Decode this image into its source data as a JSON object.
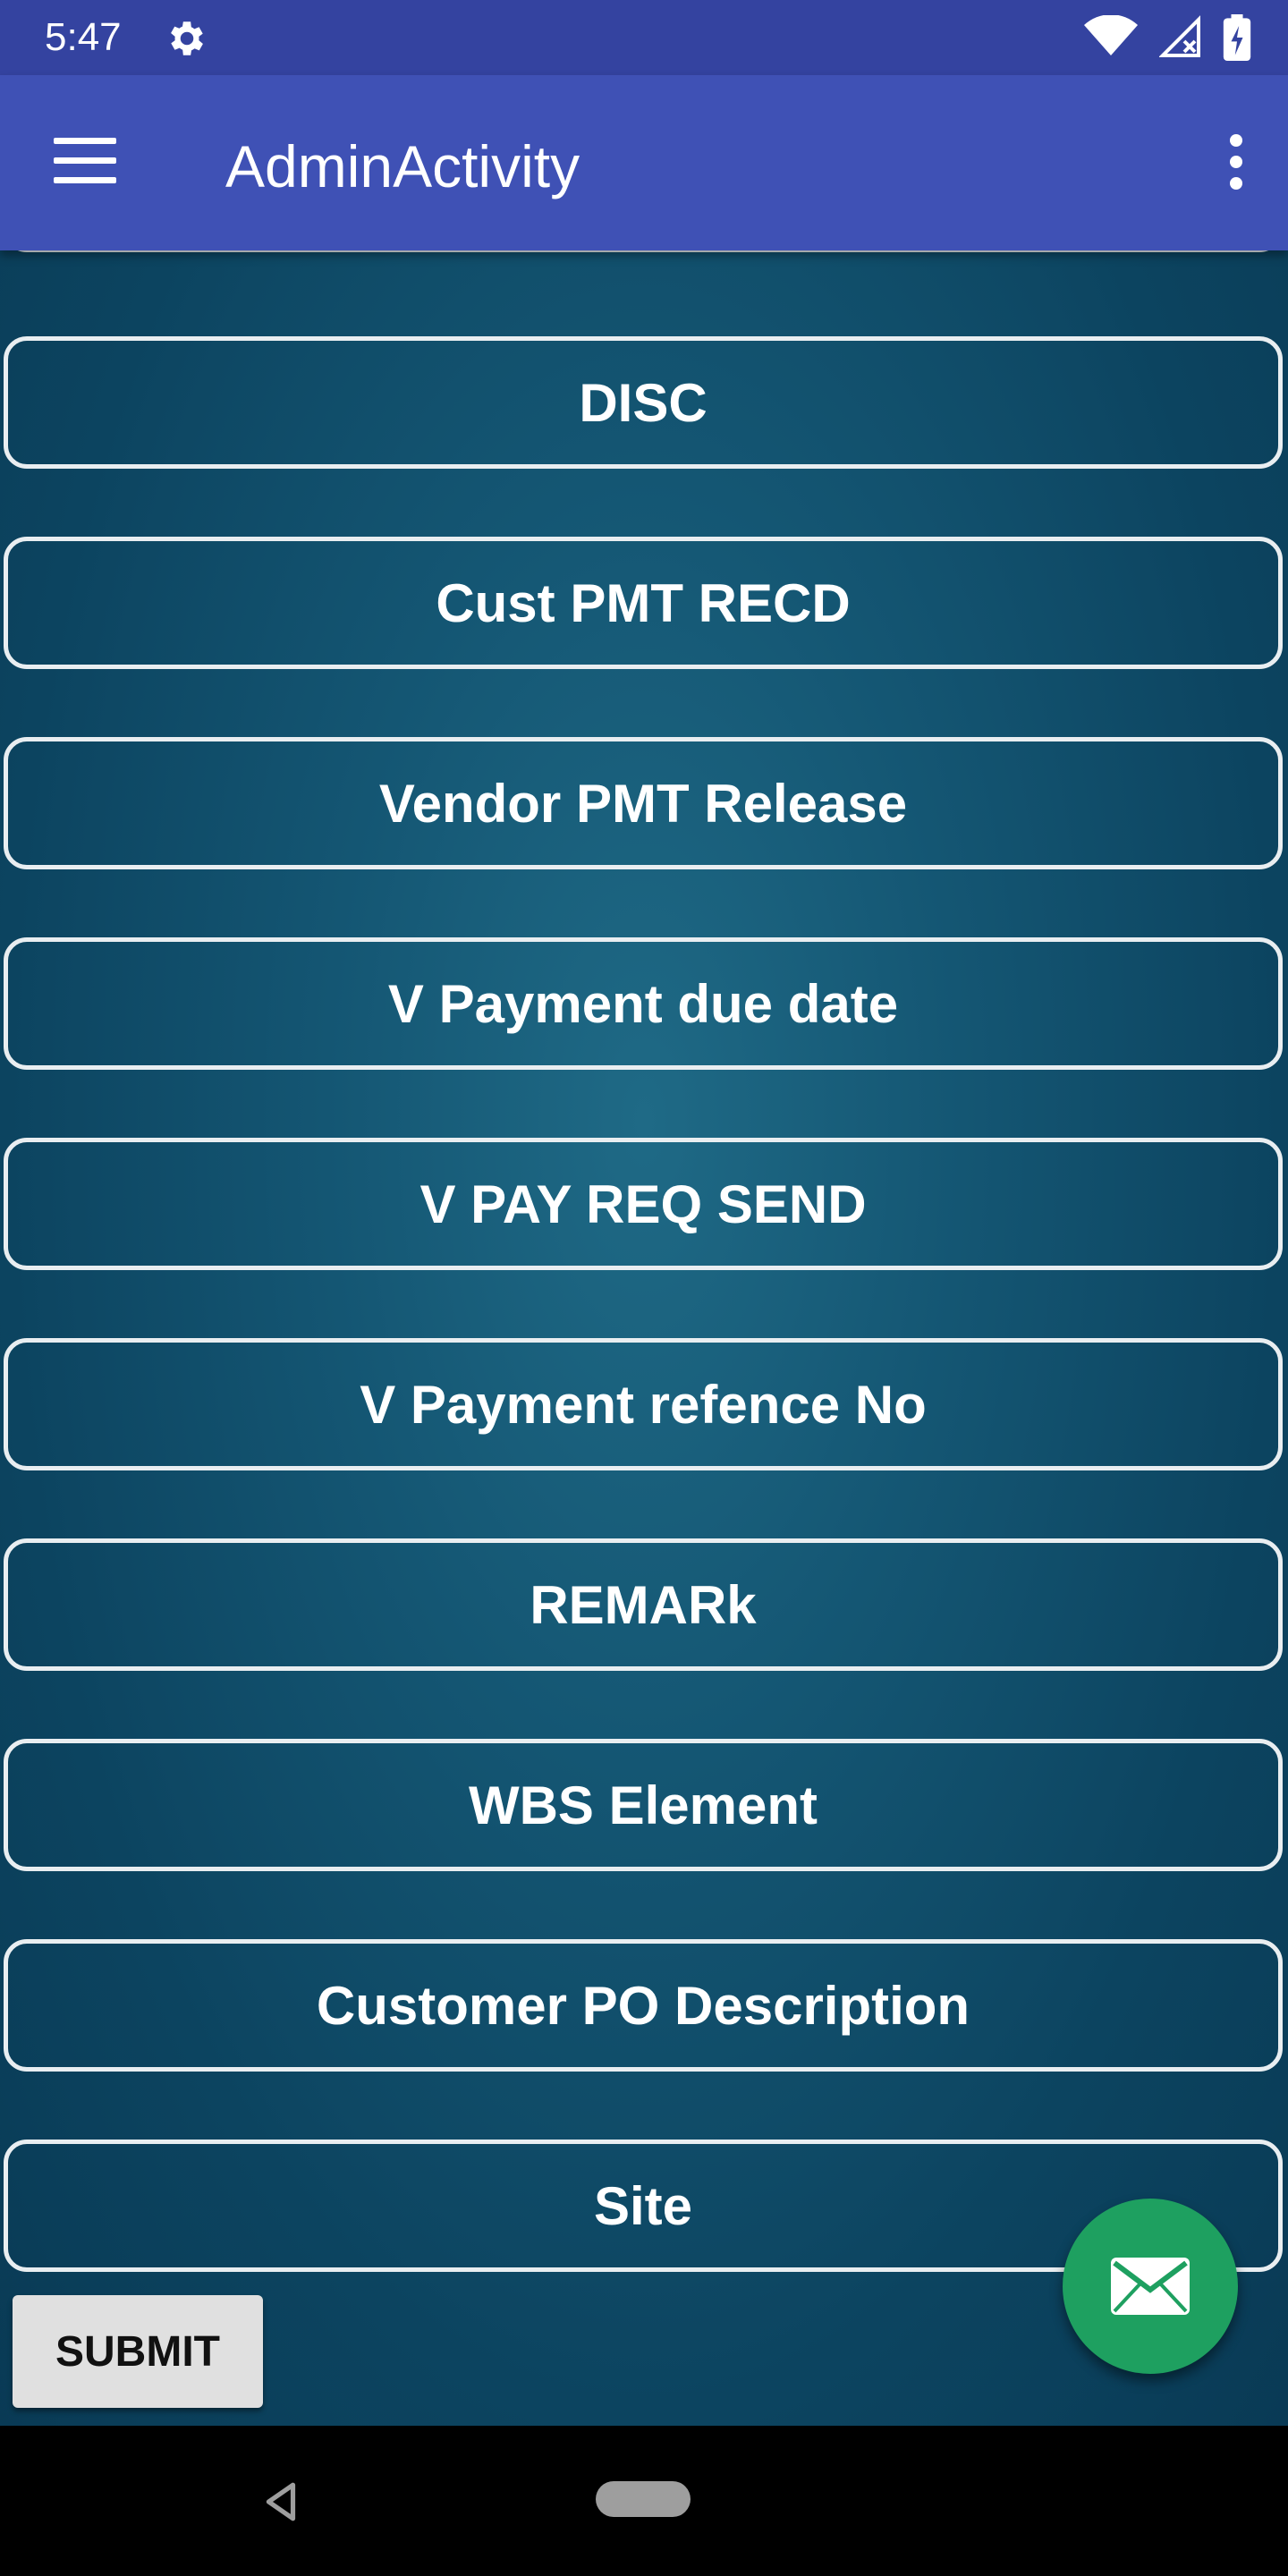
{
  "status_bar": {
    "time": "5:47",
    "icons": [
      "gear-icon",
      "wifi-icon",
      "signal-icon",
      "battery-icon"
    ]
  },
  "app_bar": {
    "title": "AdminActivity",
    "menu_icon": "hamburger-menu-icon",
    "overflow_icon": "more-vertical-icon"
  },
  "form": {
    "fields": [
      {
        "label": ""
      },
      {
        "label": "DISC"
      },
      {
        "label": "Cust PMT RECD"
      },
      {
        "label": "Vendor PMT Release"
      },
      {
        "label": "V Payment due date"
      },
      {
        "label": "V PAY REQ SEND"
      },
      {
        "label": "V Payment refence No"
      },
      {
        "label": "REMARk"
      },
      {
        "label": "WBS Element"
      },
      {
        "label": "Customer PO Description"
      },
      {
        "label": "Site"
      }
    ],
    "submit_label": "SUBMIT"
  },
  "fab": {
    "icon": "mail-icon",
    "color": "#1ea060"
  },
  "colors": {
    "app_bar": "#3f51b5",
    "status_bar": "#3443a0",
    "field_border": "#e9eef1"
  }
}
